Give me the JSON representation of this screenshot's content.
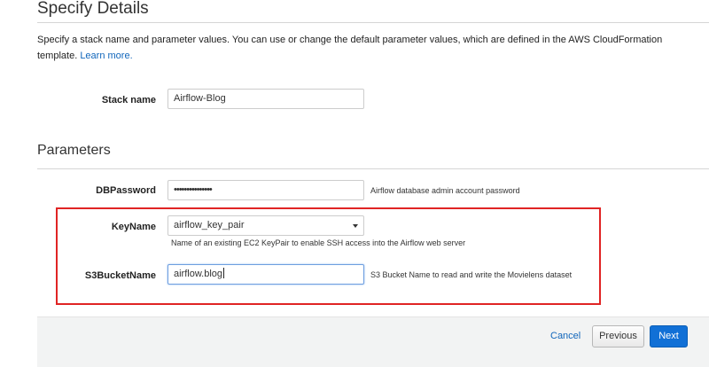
{
  "page": {
    "title": "Specify Details",
    "description": "Specify a stack name and parameter values. You can use or change the default parameter values, which are defined in the AWS CloudFormation template.",
    "learn_more": "Learn more."
  },
  "stack": {
    "label": "Stack name",
    "value": "Airflow-Blog"
  },
  "parameters": {
    "title": "Parameters",
    "db_password": {
      "label": "DBPassword",
      "value": "•••••••••••••••",
      "hint": "Airflow database admin account password"
    },
    "key_name": {
      "label": "KeyName",
      "value": "airflow_key_pair",
      "hint": "Name of an existing EC2 KeyPair to enable SSH access into the Airflow web server"
    },
    "s3_bucket_name": {
      "label": "S3BucketName",
      "value": "airflow.blog",
      "hint": "S3 Bucket Name to read and write the Movielens dataset"
    }
  },
  "footer": {
    "cancel": "Cancel",
    "previous": "Previous",
    "next": "Next"
  },
  "colors": {
    "accent": "#1170d6",
    "link": "#1166bb",
    "highlight": "#e02424"
  },
  "icons": {
    "select_arrow": "chevron-down-icon"
  }
}
